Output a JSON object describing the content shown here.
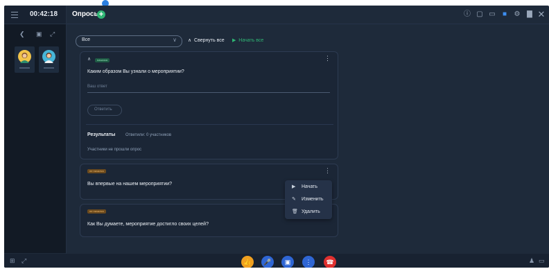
{
  "header": {
    "timer": "00:42:18",
    "title": "Опросы"
  },
  "filter": {
    "value": "Все",
    "collapse_all": "Свернуть все",
    "start_all": "Начать все"
  },
  "cards": [
    {
      "status": "начался",
      "question": "Каким образом Вы узнали о мероприятии?",
      "answer_placeholder": "Ваш ответ",
      "answer_button": "Ответить",
      "results_label": "Результаты",
      "answered_text": "Ответили: 0 участников",
      "no_participants_text": "Участники не прошли опрос"
    },
    {
      "status": "не начался",
      "question": "Вы впервые на нашем мероприятии?"
    },
    {
      "status": "не начался",
      "question": "Как Вы думаете, мероприятие достигло своих целей?"
    }
  ],
  "context_menu": {
    "items": [
      {
        "icon": "play-icon",
        "label": "Начать"
      },
      {
        "icon": "pencil-icon",
        "label": "Изменить"
      },
      {
        "icon": "trash-icon",
        "label": "Удалить"
      }
    ]
  },
  "colors": {
    "background": "#1e2a3a",
    "accent_green": "#2fb574",
    "accent_blue": "#2f66d4",
    "hangup_red": "#e0302f",
    "like_orange": "#f0a020"
  }
}
